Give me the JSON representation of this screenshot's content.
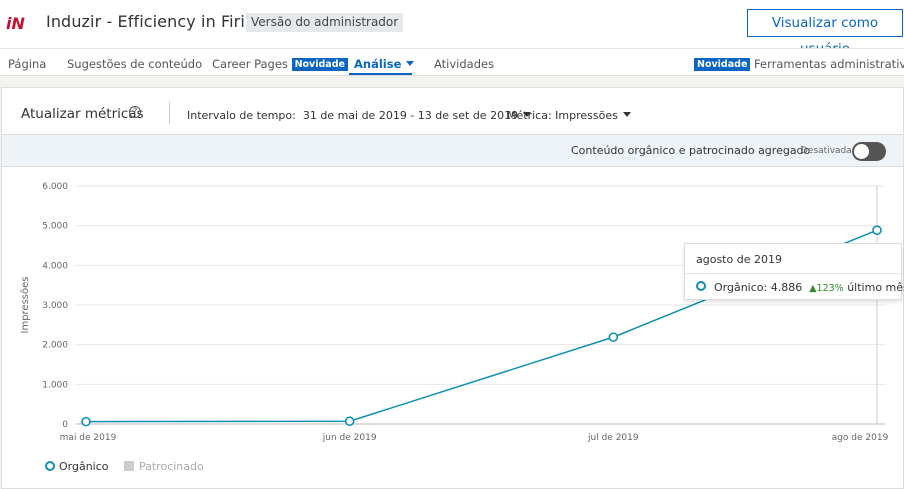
{
  "header": {
    "logo_text": "iN",
    "company_name": "Induzir - Efficiency in Firing",
    "admin_badge": "Versão do administrador",
    "view_as_user": "Visualizar como usuário"
  },
  "nav": {
    "items": [
      {
        "label": "Página"
      },
      {
        "label": "Sugestões de conteúdo"
      },
      {
        "label": "Career Pages",
        "badge": "Novidade"
      },
      {
        "label": "Análise",
        "active": true
      },
      {
        "label": "Atividades"
      }
    ],
    "admin_tools_badge": "Novidade",
    "admin_tools_label": "Ferramentas administrativas"
  },
  "metrics": {
    "title": "Atualizar métricas",
    "help_icon": "question-circle-icon",
    "time_range_label": "Intervalo de tempo:",
    "time_range_value": "31 de mai de 2019 - 13 de set de 2019",
    "metric_label": "Métrica:",
    "metric_value": "Impressões"
  },
  "toggle": {
    "label": "Conteúdo orgânico e patrocinado agregado",
    "state": "Desativada",
    "on": false
  },
  "tooltip": {
    "title": "agosto de 2019",
    "series": "Orgânico:",
    "value": "4.886",
    "change": "▲123%",
    "change_suffix": "último mês"
  },
  "legend": {
    "organic": "Orgânico",
    "sponsored": "Patrocinado"
  },
  "colors": {
    "accent": "#0a66c2",
    "organic": "#0e8fb2",
    "sponsored": "#cccccc",
    "positive": "#338a2e"
  },
  "chart_data": {
    "type": "line",
    "categories": [
      "mai de 2019",
      "jun de 2019",
      "jul de 2019",
      "ago de 2019"
    ],
    "series": [
      {
        "name": "Orgânico",
        "values": [
          60,
          70,
          2190,
          4886
        ]
      }
    ],
    "ylabel": "Impressões",
    "ylim": [
      0,
      6000
    ],
    "yticks": [
      "0",
      "1.000",
      "2.000",
      "3.000",
      "4.000",
      "5.000",
      "6.000"
    ],
    "grid": true,
    "hover_index": 3
  }
}
